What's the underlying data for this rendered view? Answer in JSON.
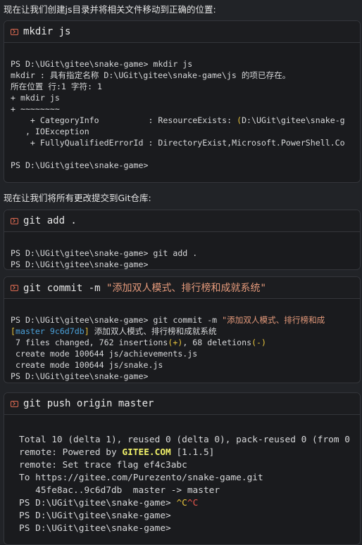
{
  "notes": {
    "n1": "现在让我们创建js目录并将相关文件移动到正确的位置:",
    "n2": "现在让我们将所有更改提交到Git仓库:"
  },
  "cards": {
    "mkdir": {
      "title": "mkdir js",
      "lines": [
        "PS D:\\UGit\\gitee\\snake-game> mkdir js",
        "mkdir : 具有指定名称 D:\\UGit\\gitee\\snake-game\\js 的项已存在。",
        "所在位置 行:1 字符: 1",
        "+ mkdir js",
        "+ ~~~~~~~~",
        "    + CategoryInfo          : ResourceExists: ",
        "   , IOException",
        "    + FullyQualifiedErrorId : DirectoryExist,Microsoft.PowerShell.Co",
        "",
        "PS D:\\UGit\\gitee\\snake-game>"
      ],
      "paren_open": "(",
      "path_tail": "D:\\UGit\\gitee\\snake-g"
    },
    "add": {
      "title": "git add .",
      "lines": [
        "PS D:\\UGit\\gitee\\snake-game> git add .",
        "PS D:\\UGit\\gitee\\snake-game>"
      ]
    },
    "commit": {
      "title_cmd": "git commit -m ",
      "title_msg": "\"添加双人模式、排行榜和成就系统\"",
      "prompt_line_cmd": "PS D:\\UGit\\gitee\\snake-game> git commit -m ",
      "prompt_line_msg": "\"添加双人模式、排行榜和成",
      "branch_open": "[",
      "branch_name": "master",
      "branch_hash": "9c6d7db",
      "branch_close": "]",
      "branch_msg": " 添加双人模式、排行榜和成就系统",
      "stats_a": " 7 files changed, 762 insertions",
      "plus": "(+)",
      "stats_b": ", 68 deletions",
      "minus": "(-)",
      "create1": " create mode 100644 js/achievements.js",
      "create2": " create mode 100644 js/snake.js",
      "prompt_end": "PS D:\\UGit\\gitee\\snake-game>"
    },
    "push": {
      "title": "git push origin master",
      "l1": "Total 10 (delta 1), reused 0 (delta 0), pack-reused 0 (from 0",
      "l2a": "remote: Powered by ",
      "l2b": "GITEE.COM",
      "l2c": " [1.1.5]",
      "l3": "remote: Set trace flag ef4c3abc",
      "l4": "To https://gitee.com/Purezento/snake-game.git",
      "l5": "   45fe8ac..9c6d7db  master -> master",
      "l6a": "PS D:\\UGit\\gitee\\snake-game> ",
      "l6b": "^C",
      "l6c": "^C",
      "l7": "PS D:\\UGit\\gitee\\snake-game>",
      "l8": "PS D:\\UGit\\gitee\\snake-game>"
    }
  },
  "colors": {
    "accent": "#e06b52",
    "yellow": "#e8c43c",
    "cyan": "#4aa0d8",
    "red": "#e8564d"
  }
}
